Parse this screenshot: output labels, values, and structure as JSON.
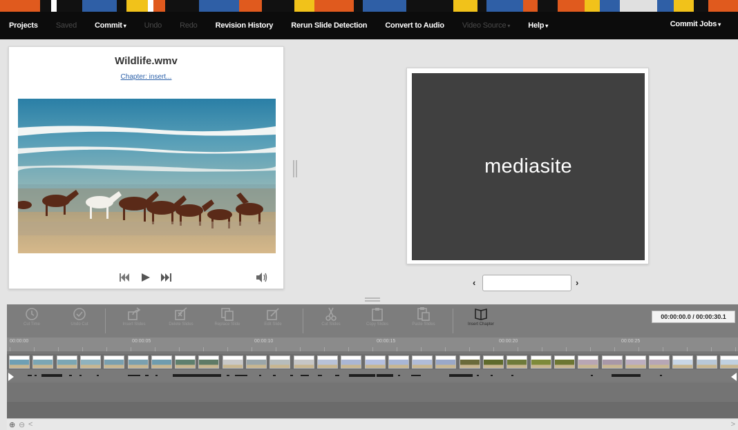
{
  "menu": {
    "projects": "Projects",
    "saved": "Saved",
    "commit": "Commit",
    "undo": "Undo",
    "redo": "Redo",
    "revision_history": "Revision History",
    "rerun_slide_detection": "Rerun Slide Detection",
    "convert_to_audio": "Convert to Audio",
    "video_source": "Video Source",
    "help": "Help",
    "commit_jobs": "Commit Jobs",
    "caret": "▾"
  },
  "video_panel": {
    "title": "Wildlife.wmv",
    "chapter_link": "Chapter: insert..."
  },
  "slide_panel": {
    "slide_text": "mediasite",
    "prev": "‹",
    "next": "›",
    "slide_input_value": ""
  },
  "toolbar": {
    "tools": [
      {
        "name": "cut-time",
        "label": "Cut Time",
        "icon": "clock-icon",
        "enabled": false
      },
      {
        "name": "undo-cut",
        "label": "Undo Cut",
        "icon": "clock-check-icon",
        "enabled": false
      },
      {
        "name": "insert-slides",
        "label": "Insert Slides",
        "icon": "share-icon",
        "enabled": false
      },
      {
        "name": "delete-slides",
        "label": "Delete Slides",
        "icon": "edit-x-icon",
        "enabled": false
      },
      {
        "name": "replace-slide",
        "label": "Replace Slide",
        "icon": "copy-icon",
        "enabled": false
      },
      {
        "name": "edit-slide",
        "label": "Edit Slide",
        "icon": "pencil-box-icon",
        "enabled": false
      },
      {
        "name": "cut-slides",
        "label": "Cut Slides",
        "icon": "scissors-icon",
        "enabled": false
      },
      {
        "name": "copy-slides",
        "label": "Copy Slides",
        "icon": "clipboard-icon",
        "enabled": false
      },
      {
        "name": "paste-slides",
        "label": "Paste Slides",
        "icon": "paste-icon",
        "enabled": false
      },
      {
        "name": "insert-chapter",
        "label": "Insert Chapter",
        "icon": "book-icon",
        "enabled": true
      }
    ],
    "time_display": "00:00:00.0 / 00:00:30.1"
  },
  "timeline": {
    "ticks": [
      "00:00:00",
      "00:00:05",
      "00:00:10",
      "00:00:15",
      "00:00:20",
      "00:00:25"
    ]
  },
  "colors": {
    "menubar": "#0c0c0c",
    "slide_screen": "#404040",
    "link": "#2a5fa8"
  }
}
